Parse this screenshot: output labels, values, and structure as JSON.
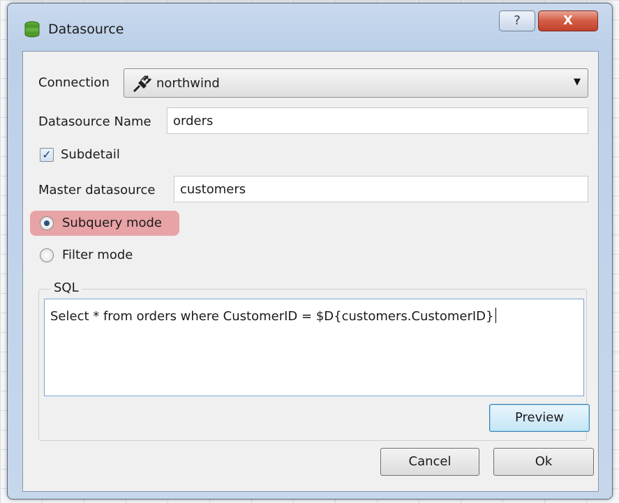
{
  "window": {
    "title": "Datasource",
    "icon": "database-icon",
    "help_label": "?",
    "close_label": "X"
  },
  "form": {
    "connection_label": "Connection",
    "connection_value": "northwind",
    "connection_icon": "plug-icon",
    "datasource_name_label": "Datasource Name",
    "datasource_name_value": "orders",
    "subdetail_label": "Subdetail",
    "subdetail_checked": true,
    "subdetail_check_glyph": "✓",
    "master_datasource_label": "Master datasource",
    "master_datasource_value": "customers",
    "subquery_mode_label": "Subquery mode",
    "filter_mode_label": "Filter mode",
    "selected_mode": "Subquery mode"
  },
  "sql": {
    "group_label": "SQL",
    "query": "Select * from orders where CustomerID = $D{customers.CustomerID}",
    "preview_label": "Preview"
  },
  "buttons": {
    "cancel_label": "Cancel",
    "ok_label": "Ok"
  },
  "colors": {
    "highlight": "#e8a3a6",
    "title_bar": "#bcd0e8",
    "close_button": "#c2412a"
  }
}
